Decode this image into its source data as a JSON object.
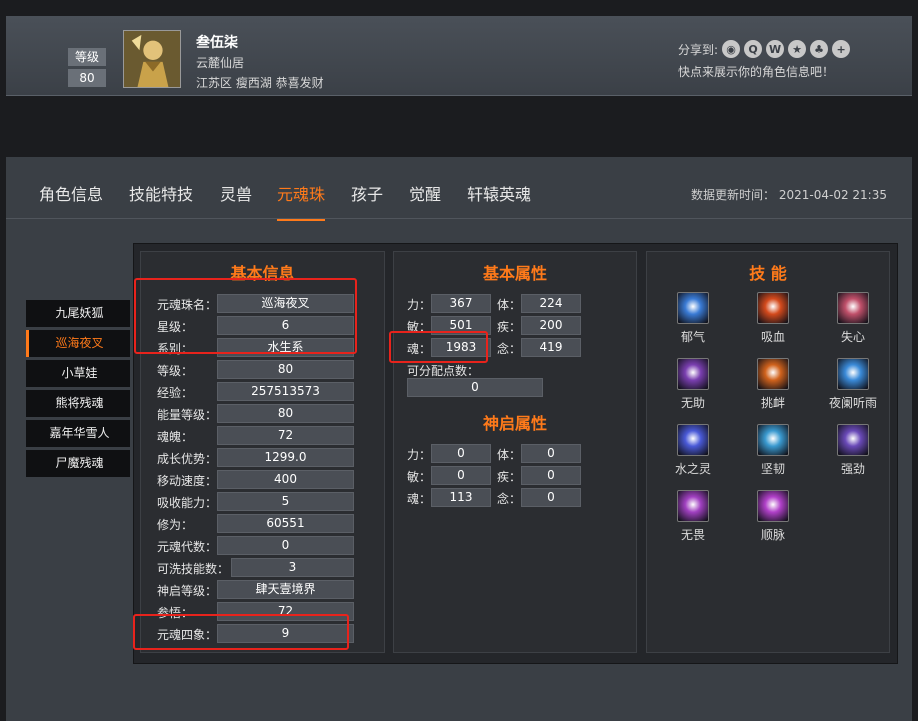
{
  "profile": {
    "level_label": "等级",
    "level_value": "80",
    "name": "叁伍柒",
    "server": "云麓仙居",
    "guild": "江苏区 瘦西湖 恭喜发财",
    "share_label": "分享到:",
    "share_icons": [
      "wechat-icon",
      "qq-icon",
      "weibo-icon",
      "star-icon",
      "tencent-icon",
      "plus-icon"
    ],
    "share_tip": "快点来展示你的角色信息吧！"
  },
  "tabs": [
    {
      "label": "角色信息",
      "active": false
    },
    {
      "label": "技能特技",
      "active": false
    },
    {
      "label": "灵兽",
      "active": false
    },
    {
      "label": "元魂珠",
      "active": true
    },
    {
      "label": "孩子",
      "active": false
    },
    {
      "label": "觉醒",
      "active": false
    },
    {
      "label": "轩辕英魂",
      "active": false
    }
  ],
  "update_time": "数据更新时间： 2021-04-02 21:35",
  "souls": [
    {
      "label": "九尾妖狐",
      "active": false
    },
    {
      "label": "巡海夜叉",
      "active": true
    },
    {
      "label": "小草娃",
      "active": false
    },
    {
      "label": "熊将残魂",
      "active": false
    },
    {
      "label": "嘉年华雪人",
      "active": false
    },
    {
      "label": "尸魔残魂",
      "active": false
    }
  ],
  "basic_info": {
    "title": "基本信息",
    "rows": [
      {
        "label": "元魂珠名：",
        "value": "巡海夜叉"
      },
      {
        "label": "星级：",
        "value": "6"
      },
      {
        "label": "系别：",
        "value": "水生系"
      },
      {
        "label": "等级：",
        "value": "80"
      },
      {
        "label": "经验：",
        "value": "257513573"
      },
      {
        "label": "能量等级：",
        "value": "80"
      },
      {
        "label": "魂魄：",
        "value": "72"
      },
      {
        "label": "成长优势：",
        "value": "1299.0"
      },
      {
        "label": "移动速度：",
        "value": "400"
      },
      {
        "label": "吸收能力：",
        "value": "5"
      },
      {
        "label": "修为：",
        "value": "60551"
      },
      {
        "label": "元魂代数：",
        "value": "0"
      },
      {
        "label": "可洗技能数：",
        "value": "3"
      },
      {
        "label": "神启等级：",
        "value": "肆天壹境界"
      },
      {
        "label": "参悟：",
        "value": "72"
      },
      {
        "label": "元魂四象：",
        "value": "9"
      }
    ]
  },
  "basic_attrs": {
    "title": "基本属性",
    "rows": [
      {
        "l1": "力：",
        "v1": "367",
        "l2": "体：",
        "v2": "224"
      },
      {
        "l1": "敏：",
        "v1": "501",
        "l2": "疾：",
        "v2": "200"
      },
      {
        "l1": "魂：",
        "v1": "1983",
        "l2": "念：",
        "v2": "419"
      }
    ],
    "free_points_label": "可分配点数：",
    "free_points_value": "0"
  },
  "divine_attrs": {
    "title": "神启属性",
    "rows": [
      {
        "l1": "力：",
        "v1": "0",
        "l2": "体：",
        "v2": "0"
      },
      {
        "l1": "敏：",
        "v1": "0",
        "l2": "疾：",
        "v2": "0"
      },
      {
        "l1": "魂：",
        "v1": "113",
        "l2": "念：",
        "v2": "0"
      }
    ]
  },
  "skills": {
    "title": "技 能",
    "items": [
      {
        "label": "郁气",
        "icon": "wind-spirit-icon",
        "color": "#3a7bd5"
      },
      {
        "label": "吸血",
        "icon": "blood-drain-icon",
        "color": "#d44a1c"
      },
      {
        "label": "失心",
        "icon": "mind-loss-icon",
        "color": "#c0506a"
      },
      {
        "label": "无助",
        "icon": "helpless-icon",
        "color": "#7a3fb0"
      },
      {
        "label": "挑衅",
        "icon": "taunt-icon",
        "color": "#d0621c"
      },
      {
        "label": "夜阑听雨",
        "icon": "night-rain-icon",
        "color": "#3a8ad8"
      },
      {
        "label": "水之灵",
        "icon": "water-spirit-icon",
        "color": "#4a5ad8"
      },
      {
        "label": "坚韧",
        "icon": "tenacity-icon",
        "color": "#3a9ad0"
      },
      {
        "label": "强劲",
        "icon": "vigor-icon",
        "color": "#6a4ab8"
      },
      {
        "label": "无畏",
        "icon": "fearless-icon",
        "color": "#a040c0"
      },
      {
        "label": "顺脉",
        "icon": "smooth-pulse-icon",
        "color": "#b040c8"
      }
    ]
  }
}
